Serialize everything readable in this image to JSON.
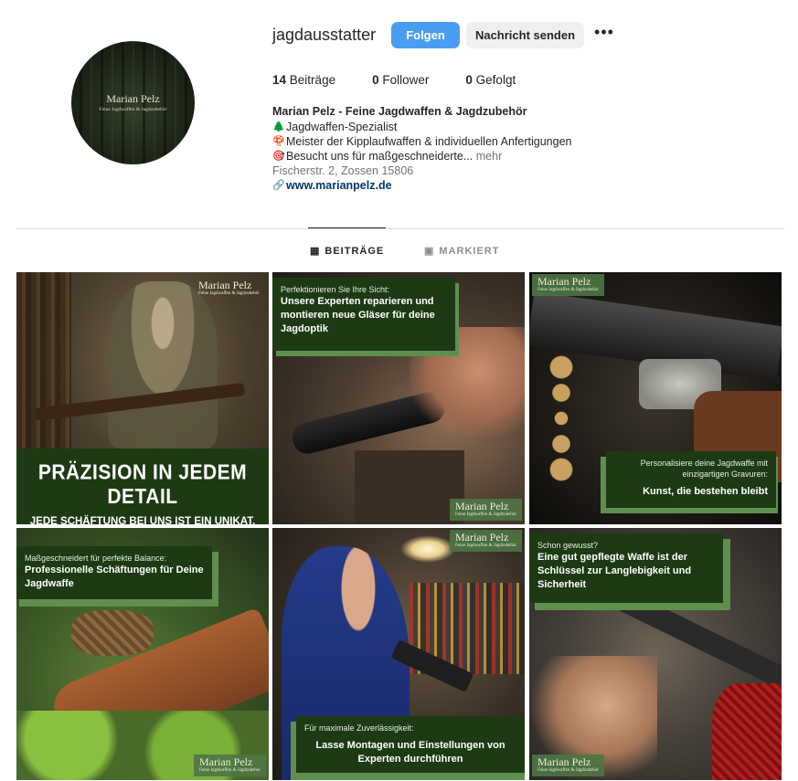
{
  "profile": {
    "username": "jagdausstatter",
    "follow_label": "Folgen",
    "message_label": "Nachricht senden",
    "more_label": "•••",
    "avatar_name": "Marian Pelz",
    "avatar_sub": "Feine Jagdwaffen & Jagdzubehör"
  },
  "stats": [
    {
      "count": "14",
      "label": "Beiträge"
    },
    {
      "count": "0",
      "label": "Follower"
    },
    {
      "count": "0",
      "label": "Gefolgt"
    }
  ],
  "bio": {
    "full_name": "Marian Pelz - Feine Jagdwaffen & Jagdzubehör",
    "line1_icon": "🌲",
    "line1": "Jagdwaffen-Spezialist",
    "line2_icon": "🍄",
    "line2": "Meister der Kipplaufwaffen & individuellen Anfertigungen",
    "line3_icon": "🎯",
    "line3": "Besucht uns für maßgeschneiderte...",
    "more": "mehr",
    "address": "Fischerstr. 2, Zossen 15806",
    "website": "www.marianpelz.de"
  },
  "tabs": [
    {
      "label": "BEITRÄGE",
      "icon": "grid-icon"
    },
    {
      "label": "MARKIERT",
      "icon": "tagged-icon"
    }
  ],
  "posts": {
    "p1": {
      "brand": "Marian Pelz",
      "brand_sub": "Feine Jagdwaffen & Jagdzubehör",
      "headline": "PRÄZISION IN JEDEM DETAIL",
      "subline": "JEDE SCHÄFTUNG BEI UNS IST EIN UNIKAT."
    },
    "p2": {
      "small": "Perfektionieren Sie Ihre Sicht:",
      "big": "Unsere Experten reparieren und montieren neue Gläser für deine Jagdoptik",
      "brand": "Marian Pelz",
      "brand_sub": "Feine Jagdwaffen & Jagdzubehör"
    },
    "p3": {
      "brand": "Marian Pelz",
      "brand_sub": "Feine Jagdwaffen & Jagdzubehör",
      "small": "Personalisiere deine Jagdwaffe mit einzigartigen Gravuren:",
      "big": "Kunst, die bestehen bleibt"
    },
    "p4": {
      "small": "Maßgeschneidert für perfekte Balance:",
      "big": "Professionelle Schäftungen für Deine Jagdwaffe",
      "brand": "Marian Pelz",
      "brand_sub": "Feine Jagdwaffen & Jagdzubehör"
    },
    "p5": {
      "brand": "Marian Pelz",
      "brand_sub": "Feine Jagdwaffen & Jagdzubehör",
      "small": "Für maximale Zuverlässigkeit:",
      "big": "Lasse Montagen und Einstellungen von Experten durchführen"
    },
    "p6": {
      "small": "Schon gewusst?",
      "big": "Eine gut gepflegte Waffe ist der Schlüssel zur Langlebigkeit und Sicherheit",
      "brand": "Marian Pelz",
      "brand_sub": "Feine Jagdwaffen & Jagdzubehör"
    }
  },
  "colors": {
    "follow": "#4a9ef1",
    "card": "#1d3a14",
    "accent": "#5f8f4f",
    "link": "#00376b"
  }
}
